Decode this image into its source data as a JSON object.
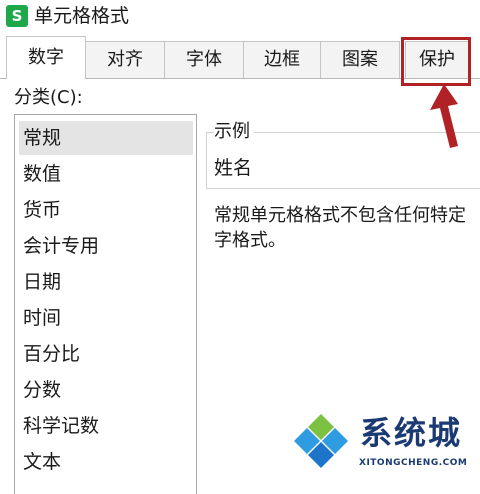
{
  "window": {
    "app_icon_glyph": "S",
    "title": "单元格格式"
  },
  "tabs": [
    {
      "label": "数字",
      "active": true
    },
    {
      "label": "对齐",
      "active": false
    },
    {
      "label": "字体",
      "active": false
    },
    {
      "label": "边框",
      "active": false
    },
    {
      "label": "图案",
      "active": false
    },
    {
      "label": "保护",
      "active": false
    }
  ],
  "category": {
    "label": "分类(C):",
    "items": [
      "常规",
      "数值",
      "货币",
      "会计专用",
      "日期",
      "时间",
      "百分比",
      "分数",
      "科学记数",
      "文本"
    ],
    "selected": "常规"
  },
  "sample": {
    "legend": "示例",
    "value": "姓名"
  },
  "description": {
    "line1": "常规单元格格式不包含任何特定",
    "line2": "字格式。"
  },
  "annotation": {
    "highlight_color": "#b02226",
    "target_tab": "保护"
  },
  "watermark": {
    "text": "系统城",
    "url": "XITONGCHENG.COM"
  }
}
